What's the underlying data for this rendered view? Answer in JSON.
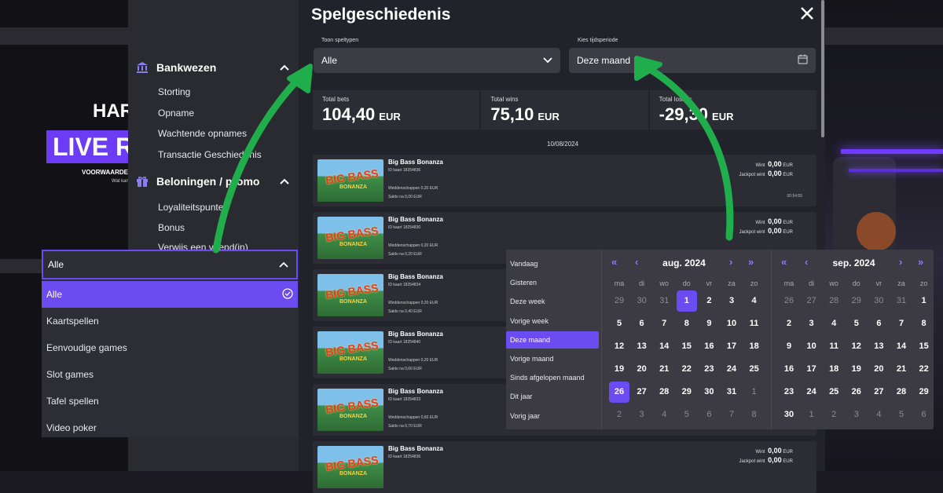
{
  "background": {
    "promo_title": "HAR",
    "promo_live": "LIVE R",
    "promo_note": "VOORWAARDE",
    "promo_small": "Wat kan"
  },
  "sidebar": {
    "banking": {
      "title": "Bankwezen",
      "icon": "bank-icon",
      "items": [
        "Storting",
        "Opname",
        "Wachtende opnames",
        "Transactie Geschiedenis"
      ]
    },
    "rewards": {
      "title": "Beloningen / promo",
      "icon": "gift-icon",
      "items": [
        "Loyaliteitspunten",
        "Bonus",
        "Verwijs een vriend(in)"
      ]
    }
  },
  "modal": {
    "title": "Spelgeschiedenis",
    "game_type_label": "Toon speltypen",
    "game_type_value": "Alle",
    "period_label": "Kies tijdsperiode",
    "period_value": "Deze maand",
    "totals": [
      {
        "label": "Total bets",
        "value": "104,40",
        "currency": "EUR"
      },
      {
        "label": "Total wins",
        "value": "75,10",
        "currency": "EUR"
      },
      {
        "label": "Total losses",
        "value": "-29,30",
        "currency": "EUR"
      }
    ],
    "date_header": "10/08/2024",
    "games": [
      {
        "title": "Big Bass Bonanza",
        "id": "ID kaart 18254836",
        "inzet": "Weddenschappen 0,20 EUR",
        "saldo": "Saldo na 0,00 EUR",
        "win": "0,00",
        "jackpot": "0,00",
        "time": "00:54:55"
      },
      {
        "title": "Big Bass Bonanza",
        "id": "ID kaart 18254830",
        "inzet": "Weddenschappen 0,20 EUR",
        "saldo": "Saldo na 0,20 EUR",
        "win": "0,00",
        "jackpot": "0,00",
        "time": ""
      },
      {
        "title": "Big Bass Bonanza",
        "id": "ID kaart 18254834",
        "inzet": "Weddenschappen 0,20 EUR",
        "saldo": "Saldo na 0,40 EUR",
        "win": "",
        "jackpot": "",
        "time": ""
      },
      {
        "title": "Big Bass Bonanza",
        "id": "ID kaart 18254840",
        "inzet": "Weddenschappen 0,20 EUR",
        "saldo": "Saldo na 0,60 EUR",
        "win": "",
        "jackpot": "",
        "time": ""
      },
      {
        "title": "Big Bass Bonanza",
        "id": "ID kaart 18254833",
        "inzet": "Weddenschappen 0,60 EUR",
        "saldo": "Saldo na 0,70 EUR",
        "win": "",
        "jackpot": "",
        "time": ""
      },
      {
        "title": "Big Bass Bonanza",
        "id": "ID kaart 18254836",
        "inzet": "",
        "saldo": "",
        "win": "0,00",
        "jackpot": "0,00",
        "time": ""
      }
    ],
    "win_label": "Wint",
    "jackpot_label": "Jackpot wint",
    "currency": "EUR",
    "thumb_big": "BIG BASS",
    "thumb_small": "BONANZA"
  },
  "dropdown": {
    "value": "Alle",
    "options": [
      "Alle",
      "Kaartspellen",
      "Eenvoudige games",
      "Slot games",
      "Tafel spellen",
      "Video poker"
    ],
    "selected_index": 0
  },
  "calendar": {
    "presets": [
      "Vandaag",
      "Gisteren",
      "Deze week",
      "Vorige week",
      "Deze maand",
      "Vorige maand",
      "Sinds afgelopen maand",
      "Dit jaar",
      "Vorig jaar"
    ],
    "selected_preset": 4,
    "weekdays": [
      "ma",
      "di",
      "wo",
      "do",
      "vr",
      "za",
      "zo"
    ],
    "months": [
      {
        "name": "aug. 2024",
        "nav_left": [
          "«",
          "‹"
        ],
        "nav_right": [
          "›",
          "»"
        ],
        "days": [
          [
            "29",
            "30",
            "31",
            "1",
            "2",
            "3",
            "4"
          ],
          [
            "5",
            "6",
            "7",
            "8",
            "9",
            "10",
            "11"
          ],
          [
            "12",
            "13",
            "14",
            "15",
            "16",
            "17",
            "18"
          ],
          [
            "19",
            "20",
            "21",
            "22",
            "23",
            "24",
            "25"
          ],
          [
            "26",
            "27",
            "28",
            "29",
            "30",
            "31",
            "1"
          ],
          [
            "2",
            "3",
            "4",
            "5",
            "6",
            "7",
            "8"
          ]
        ],
        "muted": [
          [
            0,
            0
          ],
          [
            0,
            1
          ],
          [
            0,
            2
          ],
          [
            4,
            6
          ],
          [
            5,
            0
          ],
          [
            5,
            1
          ],
          [
            5,
            2
          ],
          [
            5,
            3
          ],
          [
            5,
            4
          ],
          [
            5,
            5
          ],
          [
            5,
            6
          ]
        ],
        "selected": [
          0,
          3
        ],
        "today": [
          4,
          0
        ]
      },
      {
        "name": "sep. 2024",
        "nav_left": [
          "«",
          "‹"
        ],
        "nav_right": [
          "›",
          "»"
        ],
        "days": [
          [
            "26",
            "27",
            "28",
            "29",
            "30",
            "31",
            "1"
          ],
          [
            "2",
            "3",
            "4",
            "5",
            "6",
            "7",
            "8"
          ],
          [
            "9",
            "10",
            "11",
            "12",
            "13",
            "14",
            "15"
          ],
          [
            "16",
            "17",
            "18",
            "19",
            "20",
            "21",
            "22"
          ],
          [
            "23",
            "24",
            "25",
            "26",
            "27",
            "28",
            "29"
          ],
          [
            "30",
            "1",
            "2",
            "3",
            "4",
            "5",
            "6"
          ]
        ],
        "muted": [
          [
            0,
            0
          ],
          [
            0,
            1
          ],
          [
            0,
            2
          ],
          [
            0,
            3
          ],
          [
            0,
            4
          ],
          [
            0,
            5
          ],
          [
            5,
            1
          ],
          [
            5,
            2
          ],
          [
            5,
            3
          ],
          [
            5,
            4
          ],
          [
            5,
            5
          ],
          [
            5,
            6
          ]
        ],
        "selected": null,
        "today": null
      }
    ]
  },
  "colors": {
    "accent": "#6b4cf0",
    "arrow": "#1fae4b"
  }
}
